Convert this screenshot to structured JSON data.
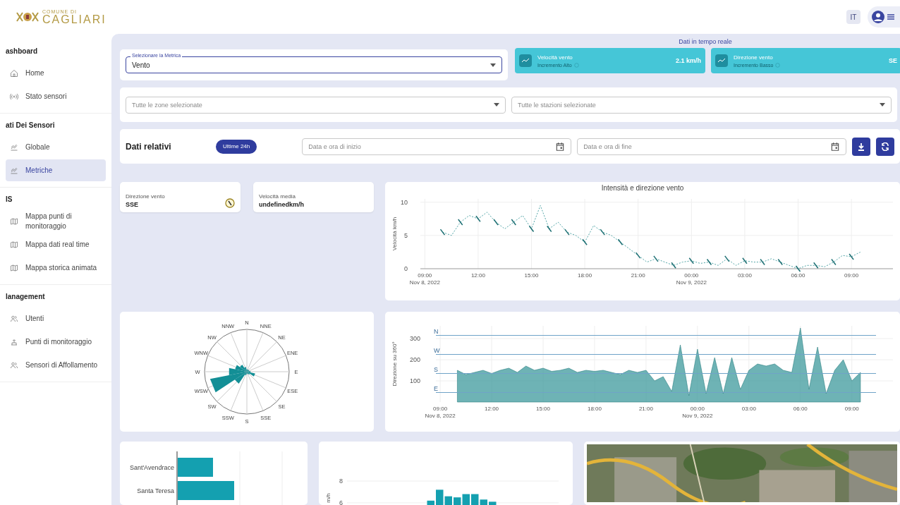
{
  "header": {
    "logo_top": "COMUNE DI",
    "logo_name": "CAGLIARI",
    "language": "IT"
  },
  "sidebar": {
    "sections": [
      {
        "title": "ashboard",
        "items": [
          {
            "label": "Home",
            "kind": "home",
            "selected": false
          },
          {
            "label": "Stato sensori",
            "kind": "sensor",
            "selected": false
          }
        ]
      },
      {
        "title": "ati Dei Sensori",
        "items": [
          {
            "label": "Globale",
            "kind": "chart",
            "selected": false
          },
          {
            "label": "Metriche",
            "kind": "chart",
            "selected": true
          }
        ]
      },
      {
        "title": "IS",
        "items": [
          {
            "label": "Mappa punti di monitoraggio",
            "kind": "map",
            "selected": false
          },
          {
            "label": "Mappa dati real time",
            "kind": "map",
            "selected": false
          },
          {
            "label": "Mappa storica animata",
            "kind": "map",
            "selected": false
          }
        ]
      },
      {
        "title": "lanagement",
        "items": [
          {
            "label": "Utenti",
            "kind": "users",
            "selected": false
          },
          {
            "label": "Punti di monitoraggio",
            "kind": "station",
            "selected": false
          },
          {
            "label": "Sensori di Affollamento",
            "kind": "users",
            "selected": false
          }
        ]
      }
    ]
  },
  "metric_select": {
    "label": "Selezionare la Metrica",
    "value": "Vento"
  },
  "realtime": {
    "title": "Dati in tempo reale",
    "cards": [
      {
        "title": "Velocità vento",
        "subtitle": "Incremento Alto",
        "value": "2.1 km/h"
      },
      {
        "title": "Direzione vento",
        "subtitle": "Incremento Basso",
        "value": "SE"
      }
    ]
  },
  "filters": [
    {
      "placeholder": "Tutte le zone selezionate"
    },
    {
      "placeholder": "Tutte le stazioni selezionate"
    }
  ],
  "range": {
    "title": "Dati relativi",
    "chip": "Ultime 24h",
    "start_placeholder": "Data e ora di inizio",
    "end_placeholder": "Data e ora di fine"
  },
  "stats": [
    {
      "label": "Direzione vento",
      "value": "SSE",
      "kind": "compass"
    },
    {
      "label": "Velocità media",
      "value": "undefinedkm/h",
      "kind": "plain"
    }
  ],
  "speed_chart": {
    "chart_data": {
      "type": "line",
      "title": "Intensità e direzione vento",
      "ylabel": "Velocità km/h",
      "grid": true,
      "ylim": [
        0,
        10.5
      ],
      "yticks": [
        0,
        5,
        10
      ],
      "categories": [
        "09:00 Nov 8, 2022",
        null,
        null,
        null,
        null,
        null,
        "12:00",
        null,
        null,
        null,
        null,
        null,
        "15:00",
        null,
        null,
        null,
        null,
        null,
        "18:00",
        null,
        null,
        null,
        null,
        null,
        "21:00",
        null,
        null,
        null,
        null,
        null,
        "00:00 Nov 9, 2022",
        null,
        null,
        null,
        null,
        null,
        "03:00",
        null,
        null,
        null,
        null,
        null,
        "06:00",
        null,
        null,
        null,
        null,
        null,
        "09:00",
        null
      ],
      "series": [
        {
          "color": "#4fa3a5",
          "line_style": "dashed",
          "values": [
            null,
            null,
            5.5,
            5,
            7,
            8,
            7.5,
            8.5,
            7,
            6,
            7,
            8,
            6,
            9.5,
            6,
            7,
            5.5,
            5,
            4,
            6.5,
            5.5,
            5,
            4,
            3,
            2,
            1,
            1.5,
            1,
            0.5,
            1,
            1.2,
            0.8,
            1,
            0.5,
            1.5,
            0.5,
            1.2,
            1,
            1,
            1.5,
            1,
            0.5,
            0,
            0.5,
            0.5,
            0.3,
            1,
            2,
            1.8,
            2.5
          ]
        }
      ]
    }
  },
  "wind_rose": {
    "directions": [
      "N",
      "NNW",
      "NNE",
      "NW",
      "NE",
      "WNW",
      "ENE",
      "W",
      "E",
      "WSW",
      "ESE",
      "SW",
      "SE",
      "SSW",
      "SSE",
      "S"
    ]
  },
  "direction_chart": {
    "chart_data": {
      "type": "area",
      "ylabel": "Direzione su 360°",
      "grid": true,
      "ylim": [
        0,
        360
      ],
      "categories": [
        "09:00 Nov 8, 2022",
        null,
        null,
        null,
        null,
        null,
        "12:00",
        null,
        null,
        null,
        null,
        null,
        "15:00",
        null,
        null,
        null,
        null,
        null,
        "18:00",
        null,
        null,
        null,
        null,
        null,
        "21:00",
        null,
        null,
        null,
        null,
        null,
        "00:00 Nov 9, 2022",
        null,
        null,
        null,
        null,
        null,
        "03:00",
        null,
        null,
        null,
        null,
        null,
        "06:00",
        null,
        null,
        null,
        null,
        null,
        "09:00",
        null
      ],
      "yticks": [
        100,
        200,
        300
      ],
      "ref_lines": [
        {
          "axis": "y",
          "value": 315,
          "label": "N"
        },
        {
          "axis": "y",
          "value": 225,
          "label": "W"
        },
        {
          "axis": "y",
          "value": 135,
          "label": "S"
        },
        {
          "axis": "y",
          "value": 45,
          "label": "E"
        }
      ],
      "series": [
        {
          "color": "#3d9a9c",
          "values": [
            null,
            null,
            150,
            130,
            140,
            150,
            135,
            150,
            160,
            140,
            170,
            150,
            160,
            145,
            150,
            160,
            140,
            150,
            145,
            150,
            140,
            130,
            150,
            140,
            150,
            100,
            120,
            50,
            270,
            30,
            250,
            40,
            210,
            40,
            210,
            60,
            150,
            180,
            170,
            180,
            150,
            140,
            350,
            60,
            260,
            40,
            150,
            200,
            100,
            140
          ]
        }
      ]
    }
  },
  "stations_chart": {
    "categories": [
      "Sant'Avendrace",
      "Santa Teresa"
    ]
  },
  "hourly_chart": {
    "chart_data": {
      "type": "bar",
      "ylabel": "m/h",
      "ylim": [
        5.8,
        8
      ],
      "yticks": [
        6,
        8
      ],
      "values": [
        null,
        null,
        null,
        null,
        null,
        null,
        null,
        null,
        null,
        6.2,
        7.2,
        6.6,
        6.5,
        6.8,
        6.8,
        6.3,
        6.1,
        null,
        null,
        null,
        null,
        null,
        null,
        null
      ]
    }
  }
}
